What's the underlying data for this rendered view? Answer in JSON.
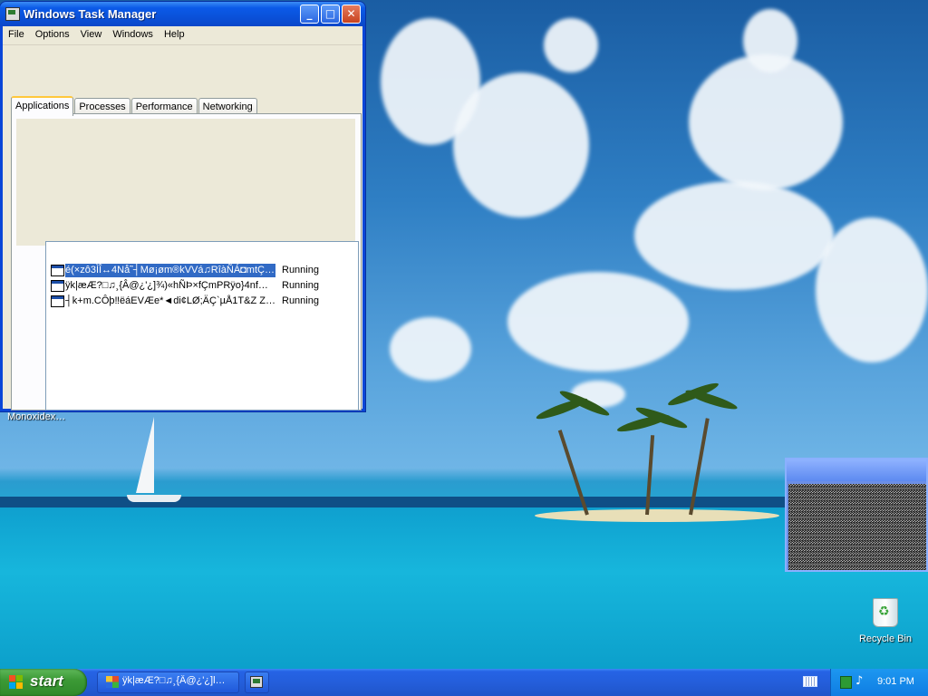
{
  "window": {
    "title": "Windows Task Manager",
    "buttons": {
      "minimize": "_",
      "maximize": "□",
      "close": "✕"
    }
  },
  "menu": [
    "File",
    "Options",
    "View",
    "Windows",
    "Help"
  ],
  "tabs": [
    {
      "label": "Applications",
      "active": true
    },
    {
      "label": "Processes",
      "active": false
    },
    {
      "label": "Performance",
      "active": false
    },
    {
      "label": "Networking",
      "active": false
    }
  ],
  "applications": [
    {
      "name": "é(×zô3ÌÎ↔4Nå˜┤Mø¡øm®kVVá♫RîàÑÁ◘mtÇ÷…",
      "status": "Running",
      "selected": true
    },
    {
      "name": "ÿk|æÆ?□♫¸{Â@¿'¿]¾)«hÑÞ×fÇmPRÿo}4nf…",
      "status": "Running",
      "selected": false
    },
    {
      "name": "┤k+m.CÔþ‼ëáEVÆe*◄di¢LØ;ÄÇ`µÅ1T&Z Z|…",
      "status": "Running",
      "selected": false
    }
  ],
  "desktop": {
    "label": "Monoxidex…",
    "recycle_bin": "Recycle Bin"
  },
  "taskbar": {
    "start": "start",
    "task_button_1": "ÿk|æÆ?□♫¸{Â@¿'¿]l…",
    "clock": "9:01 PM"
  },
  "colors": {
    "titlebar": "#0a4fd6",
    "selection": "#316ac5",
    "start_green": "#3c9a36",
    "taskbar_blue": "#245edb",
    "tab_highlight": "#ffc83c"
  },
  "icons": {
    "window": "task-manager-icon",
    "app": "application-window-icon",
    "tray": [
      "network-icon",
      "speaker-icon"
    ],
    "keyboard": "keyboard-icon",
    "recycle": "recycle-bin-icon"
  }
}
